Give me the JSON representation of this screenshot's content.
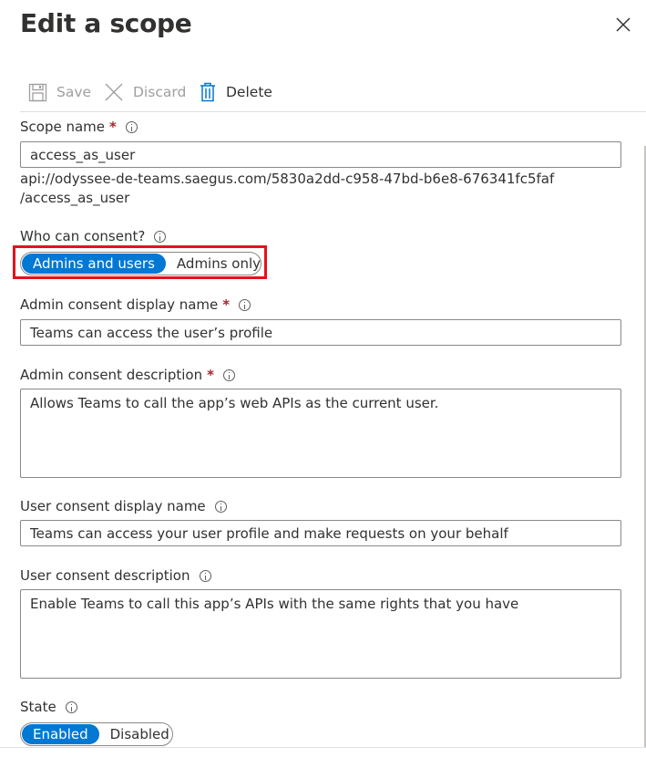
{
  "panel": {
    "title": "Edit a scope",
    "close_icon": "close-icon"
  },
  "toolbar": {
    "save_label": "Save",
    "discard_label": "Discard",
    "delete_label": "Delete"
  },
  "scope_name": {
    "label": "Scope name",
    "required": "*",
    "value": "access_as_user",
    "uri_line1": "api://odyssee-de-teams.saegus.com/5830a2dd-c958-47bd-b6e8-676341fc5faf",
    "uri_line2": "/access_as_user"
  },
  "who_can_consent": {
    "label": "Who can consent?",
    "options": [
      "Admins and users",
      "Admins only"
    ],
    "selected": "Admins and users"
  },
  "admin_consent_display_name": {
    "label": "Admin consent display name",
    "required": "*",
    "value": "Teams can access the user’s profile"
  },
  "admin_consent_description": {
    "label": "Admin consent description",
    "required": "*",
    "value": "Allows Teams to call the app’s web APIs as the current user."
  },
  "user_consent_display_name": {
    "label": "User consent display name",
    "value": "Teams can access your user profile and make requests on your behalf"
  },
  "user_consent_description": {
    "label": "User consent description",
    "value": "Enable Teams to call this app’s APIs with the same rights that you have"
  },
  "state": {
    "label": "State",
    "options": [
      "Enabled",
      "Disabled"
    ],
    "selected": "Enabled"
  },
  "colors": {
    "accent": "#0078d4",
    "highlight_border": "#e3131a",
    "required": "#a4262c"
  }
}
